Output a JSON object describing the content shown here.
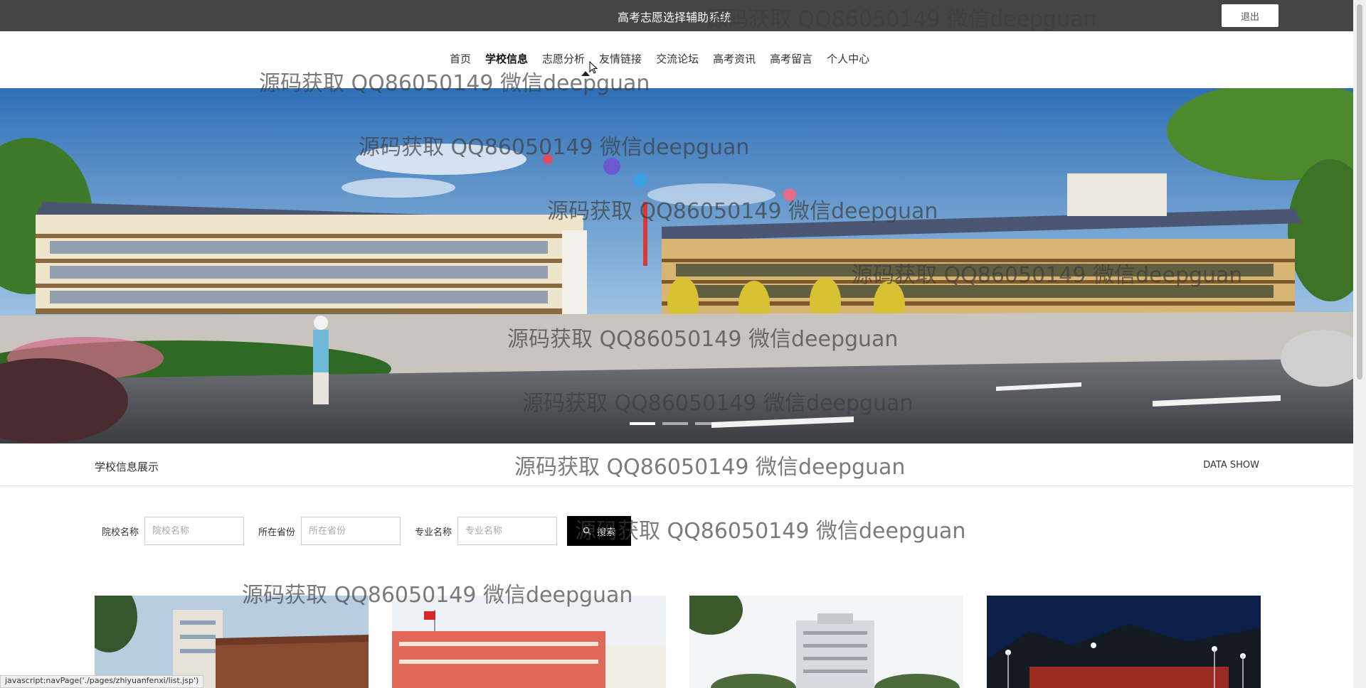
{
  "header": {
    "site_title": "高考志愿选择辅助系统",
    "logout_label": "退出"
  },
  "nav": {
    "items": [
      {
        "label": "首页"
      },
      {
        "label": "学校信息"
      },
      {
        "label": "志愿分析"
      },
      {
        "label": "友情链接"
      },
      {
        "label": "交流论坛"
      },
      {
        "label": "高考资讯"
      },
      {
        "label": "高考留言"
      },
      {
        "label": "个人中心"
      }
    ],
    "active_index": 1
  },
  "banner": {
    "slide_count": 3,
    "active_slide": 0
  },
  "section": {
    "title": "学校信息展示",
    "subtitle_en": "DATA SHOW"
  },
  "search": {
    "school_label": "院校名称",
    "school_placeholder": "院校名称",
    "province_label": "所在省份",
    "province_placeholder": "所在省份",
    "major_label": "专业名称",
    "major_placeholder": "专业名称",
    "button_label": "搜索",
    "button_icon": "search-icon"
  },
  "watermark": {
    "text": "源码获取 QQ86050149 微信deepguan"
  },
  "statusbar": {
    "text": "javascript:navPage('./pages/zhiyuanfenxi/list.jsp')"
  },
  "colors": {
    "topbar": "#454545",
    "search_button": "#000000"
  }
}
